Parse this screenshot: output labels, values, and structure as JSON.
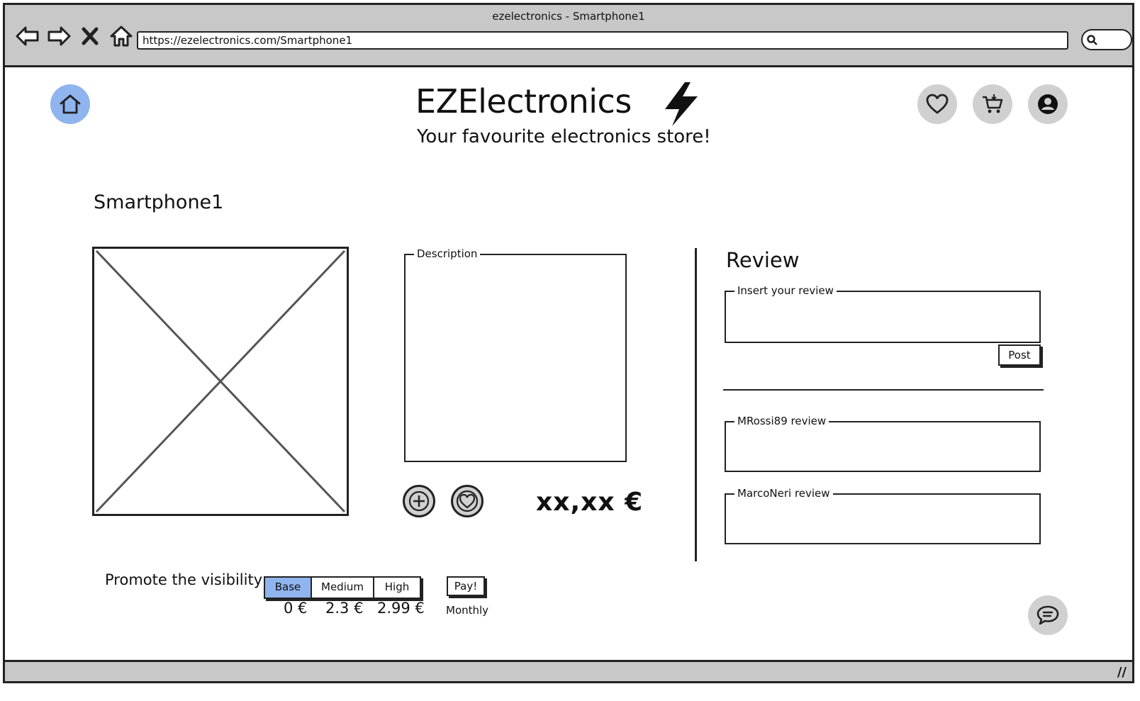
{
  "browser": {
    "title": "ezelectronics - Smartphone1",
    "url": "https://ezelectronics.com/Smartphone1"
  },
  "header": {
    "brand": "EZElectronics",
    "tagline": "Your favourite electronics store!"
  },
  "product": {
    "name": "Smartphone1",
    "description_legend": "Description",
    "price": "xx,xx €"
  },
  "reviews": {
    "title": "Review",
    "input_legend": "Insert your review",
    "post_label": "Post",
    "items": [
      {
        "legend": "MRossi89 review"
      },
      {
        "legend": "MarcoNeri review"
      }
    ]
  },
  "promote": {
    "label": "Promote the visibility :",
    "options": [
      {
        "label": "Base",
        "price": "0 €",
        "selected": true
      },
      {
        "label": "Medium",
        "price": "2.3 €",
        "selected": false
      },
      {
        "label": "High",
        "price": "2.99 €",
        "selected": false
      }
    ],
    "pay_label": "Pay!",
    "period": "Monthly"
  },
  "icons": {
    "nav": [
      "back-arrow-icon",
      "forward-arrow-icon",
      "stop-icon",
      "home-icon"
    ],
    "header": [
      "home-icon",
      "heart-icon",
      "cart-icon",
      "user-icon"
    ],
    "chat": "chat-icon"
  },
  "colors": {
    "accent": "#8fb4ee",
    "chrome": "#c8c8c8",
    "icon_bg": "#d0d0d0"
  }
}
